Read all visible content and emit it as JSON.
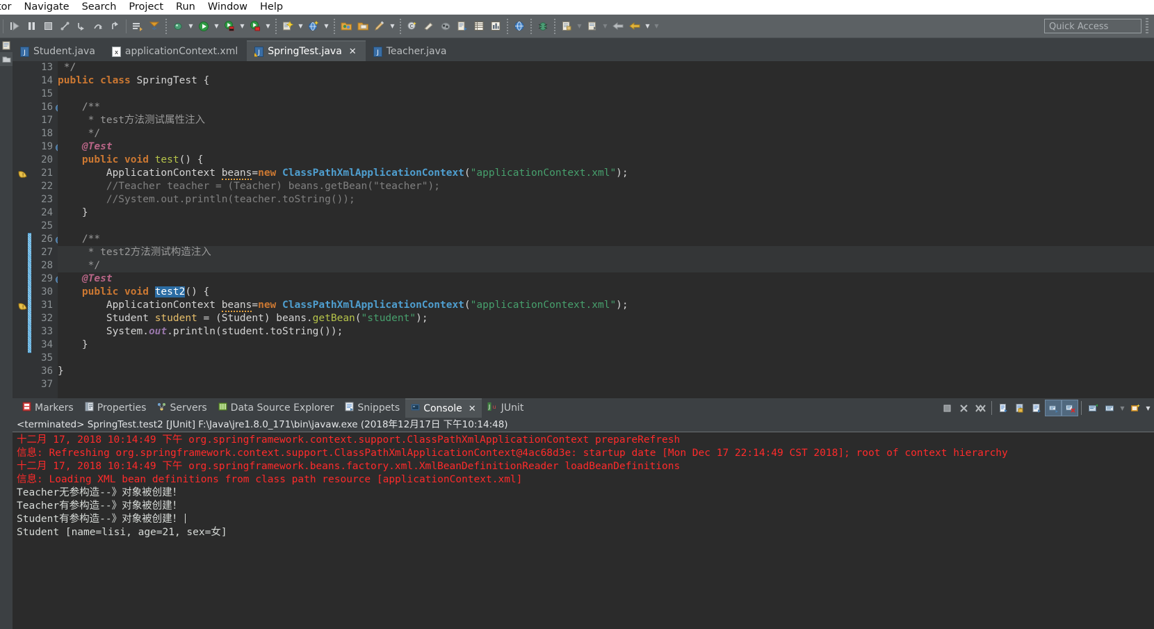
{
  "menubar": {
    "items": [
      {
        "label": "tor",
        "name": "menu-editor-clipped"
      },
      {
        "label": "Navigate",
        "name": "menu-navigate"
      },
      {
        "label": "Search",
        "name": "menu-search"
      },
      {
        "label": "Project",
        "name": "menu-project"
      },
      {
        "label": "Run",
        "name": "menu-run"
      },
      {
        "label": "Window",
        "name": "menu-window"
      },
      {
        "label": "Help",
        "name": "menu-help"
      }
    ]
  },
  "toolbar": {
    "quick_access_placeholder": "Quick Access",
    "buttons": [
      {
        "name": "skip-all-breakpoints-icon",
        "title": "Skip All Breakpoints"
      },
      {
        "name": "resume-icon",
        "title": "Resume"
      },
      {
        "name": "suspend-icon",
        "title": "Suspend"
      },
      {
        "name": "terminate-icon",
        "title": "Terminate"
      },
      {
        "name": "disconnect-icon",
        "title": "Disconnect"
      },
      {
        "name": "step-into-icon",
        "title": "Step Into"
      },
      {
        "name": "step-over-icon",
        "title": "Step Over"
      },
      {
        "name": "step-return-icon",
        "title": "Step Return"
      },
      {
        "name": "save-icon",
        "title": "Save"
      },
      {
        "name": "publish-icon",
        "title": "Publish"
      },
      {
        "name": "debug-icon",
        "title": "Debug"
      },
      {
        "name": "run-icon",
        "title": "Run"
      },
      {
        "name": "run-external-tools-icon",
        "title": "External Tools"
      },
      {
        "name": "coverage-icon",
        "title": "Coverage"
      },
      {
        "name": "new-wizard-icon",
        "title": "New"
      },
      {
        "name": "search-globe-icon",
        "title": "Open Type"
      },
      {
        "name": "open-folder-icon",
        "title": "Open Resource"
      },
      {
        "name": "open-package-icon",
        "title": "Open Package"
      },
      {
        "name": "quick-fix-icon",
        "title": "Quick Fix"
      },
      {
        "name": "new-class-icon",
        "title": "New Java Class"
      },
      {
        "name": "new-package-icon",
        "title": "New Package"
      },
      {
        "name": "java-perspective-icon",
        "title": "Java Perspective"
      },
      {
        "name": "new-report-icon",
        "title": "New Report"
      },
      {
        "name": "table-view-icon",
        "title": "Table View"
      },
      {
        "name": "chart-view-icon",
        "title": "Chart View"
      },
      {
        "name": "web-browser-icon",
        "title": "Web Browser"
      },
      {
        "name": "debug-ant-icon",
        "title": "Ant Build"
      },
      {
        "name": "annotation-icon",
        "title": "Annotation"
      },
      {
        "name": "previous-annotation-icon",
        "title": "Previous Annotation"
      },
      {
        "name": "back-icon",
        "title": "Back"
      },
      {
        "name": "forward-icon",
        "title": "Forward"
      }
    ]
  },
  "editor_tabs": [
    {
      "label": "Student.java",
      "icon": "java-file-icon",
      "active": false,
      "closable": false
    },
    {
      "label": "applicationContext.xml",
      "icon": "xml-file-icon",
      "active": false,
      "closable": false
    },
    {
      "label": "SpringTest.java",
      "icon": "java-file-warning-icon",
      "active": true,
      "closable": true,
      "close_label": "✕"
    },
    {
      "label": "Teacher.java",
      "icon": "java-file-icon",
      "active": false,
      "closable": false
    }
  ],
  "editor": {
    "lines": [
      {
        "num": "13",
        "fold": false,
        "marker": "",
        "changed": false,
        "tokens": [
          {
            "t": " */",
            "c": "jdoc"
          }
        ]
      },
      {
        "num": "14",
        "fold": false,
        "marker": "",
        "changed": false,
        "tokens": [
          {
            "t": "public class ",
            "c": "kw"
          },
          {
            "t": "SpringTest ",
            "c": "plain"
          },
          {
            "t": "{",
            "c": "plain"
          }
        ]
      },
      {
        "num": "15",
        "fold": false,
        "marker": "",
        "changed": false,
        "tokens": [
          {
            "t": "",
            "c": "plain"
          }
        ]
      },
      {
        "num": "16",
        "fold": true,
        "marker": "",
        "changed": false,
        "tokens": [
          {
            "t": "    /**",
            "c": "jdoc"
          }
        ]
      },
      {
        "num": "17",
        "fold": false,
        "marker": "",
        "changed": false,
        "tokens": [
          {
            "t": "     * test方法测试属性注入",
            "c": "jdoc"
          }
        ]
      },
      {
        "num": "18",
        "fold": false,
        "marker": "",
        "changed": false,
        "tokens": [
          {
            "t": "     */",
            "c": "jdoc"
          }
        ]
      },
      {
        "num": "19",
        "fold": true,
        "marker": "",
        "changed": false,
        "tokens": [
          {
            "t": "    @Test",
            "c": "ann"
          }
        ]
      },
      {
        "num": "20",
        "fold": false,
        "marker": "",
        "changed": false,
        "tokens": [
          {
            "t": "    ",
            "c": "plain"
          },
          {
            "t": "public void ",
            "c": "kw"
          },
          {
            "t": "test",
            "c": "mth"
          },
          {
            "t": "() {",
            "c": "plain"
          }
        ]
      },
      {
        "num": "21",
        "fold": false,
        "marker": "warning",
        "changed": false,
        "tokens": [
          {
            "t": "        ApplicationContext ",
            "c": "plain"
          },
          {
            "t": "beans",
            "c": "warnu"
          },
          {
            "t": "=",
            "c": "plain"
          },
          {
            "t": "new ",
            "c": "kw"
          },
          {
            "t": "ClassPathXmlApplicationContext",
            "c": "cls"
          },
          {
            "t": "(",
            "c": "plain"
          },
          {
            "t": "\"applicationContext.xml\"",
            "c": "str"
          },
          {
            "t": ");",
            "c": "plain"
          }
        ]
      },
      {
        "num": "22",
        "fold": false,
        "marker": "",
        "changed": false,
        "tokens": [
          {
            "t": "        //Teacher teacher = (Teacher) beans.getBean(\"teacher\");",
            "c": "cmt"
          }
        ]
      },
      {
        "num": "23",
        "fold": false,
        "marker": "",
        "changed": false,
        "tokens": [
          {
            "t": "        //System.out.println(teacher.toString());",
            "c": "cmt"
          }
        ]
      },
      {
        "num": "24",
        "fold": false,
        "marker": "",
        "changed": false,
        "tokens": [
          {
            "t": "    }",
            "c": "plain"
          }
        ]
      },
      {
        "num": "25",
        "fold": false,
        "marker": "",
        "changed": false,
        "tokens": [
          {
            "t": "",
            "c": "plain"
          }
        ]
      },
      {
        "num": "26",
        "fold": true,
        "marker": "",
        "changed": true,
        "tokens": [
          {
            "t": "    /**",
            "c": "jdoc"
          }
        ]
      },
      {
        "num": "27",
        "fold": false,
        "marker": "",
        "changed": true,
        "highlight": true,
        "tokens": [
          {
            "t": "     * test2方法测试构造注入",
            "c": "jdoc"
          }
        ]
      },
      {
        "num": "28",
        "fold": false,
        "marker": "",
        "changed": true,
        "highlight": true,
        "tokens": [
          {
            "t": "     */",
            "c": "jdoc"
          }
        ]
      },
      {
        "num": "29",
        "fold": true,
        "marker": "",
        "changed": true,
        "tokens": [
          {
            "t": "    @Test",
            "c": "ann"
          }
        ]
      },
      {
        "num": "30",
        "fold": false,
        "marker": "",
        "changed": true,
        "tokens": [
          {
            "t": "    ",
            "c": "plain"
          },
          {
            "t": "public void ",
            "c": "kw"
          },
          {
            "t": "test2",
            "c": "selbox"
          },
          {
            "t": "() {",
            "c": "plain"
          }
        ]
      },
      {
        "num": "31",
        "fold": false,
        "marker": "warning",
        "changed": true,
        "tokens": [
          {
            "t": "        ApplicationContext ",
            "c": "plain"
          },
          {
            "t": "beans",
            "c": "warnu"
          },
          {
            "t": "=",
            "c": "plain"
          },
          {
            "t": "new ",
            "c": "kw"
          },
          {
            "t": "ClassPathXmlApplicationContext",
            "c": "cls"
          },
          {
            "t": "(",
            "c": "plain"
          },
          {
            "t": "\"applicationContext.xml\"",
            "c": "str"
          },
          {
            "t": ");",
            "c": "plain"
          }
        ]
      },
      {
        "num": "32",
        "fold": false,
        "marker": "",
        "changed": true,
        "tokens": [
          {
            "t": "        Student ",
            "c": "plain"
          },
          {
            "t": "student",
            "c": "mthy"
          },
          {
            "t": " = (Student) beans.",
            "c": "plain"
          },
          {
            "t": "getBean",
            "c": "mth"
          },
          {
            "t": "(",
            "c": "plain"
          },
          {
            "t": "\"student\"",
            "c": "str"
          },
          {
            "t": ");",
            "c": "plain"
          }
        ]
      },
      {
        "num": "33",
        "fold": false,
        "marker": "",
        "changed": true,
        "tokens": [
          {
            "t": "        System.",
            "c": "plain"
          },
          {
            "t": "out",
            "c": "fld"
          },
          {
            "t": ".println(student.toString());",
            "c": "plain"
          }
        ]
      },
      {
        "num": "34",
        "fold": false,
        "marker": "",
        "changed": true,
        "tokens": [
          {
            "t": "    }",
            "c": "plain"
          }
        ]
      },
      {
        "num": "35",
        "fold": false,
        "marker": "",
        "changed": false,
        "tokens": [
          {
            "t": "",
            "c": "plain"
          }
        ]
      },
      {
        "num": "36",
        "fold": false,
        "marker": "",
        "changed": false,
        "tokens": [
          {
            "t": "}",
            "c": "plain"
          }
        ]
      },
      {
        "num": "37",
        "fold": false,
        "marker": "",
        "changed": false,
        "tokens": [
          {
            "t": "",
            "c": "plain"
          }
        ]
      }
    ]
  },
  "bottom_panel": {
    "tabs": [
      {
        "label": "Markers",
        "icon": "markers-icon",
        "active": false,
        "closable": false
      },
      {
        "label": "Properties",
        "icon": "properties-icon",
        "active": false,
        "closable": false
      },
      {
        "label": "Servers",
        "icon": "servers-icon",
        "active": false,
        "closable": false
      },
      {
        "label": "Data Source Explorer",
        "icon": "data-source-explorer-icon",
        "active": false,
        "closable": false
      },
      {
        "label": "Snippets",
        "icon": "snippets-icon",
        "active": false,
        "closable": false
      },
      {
        "label": "Console",
        "icon": "console-icon",
        "active": true,
        "closable": true,
        "close_label": "✕"
      },
      {
        "label": "JUnit",
        "icon": "junit-icon",
        "active": false,
        "closable": false
      }
    ],
    "tools": [
      {
        "name": "terminate-console-icon",
        "selected": false
      },
      {
        "name": "remove-launch-icon",
        "selected": false
      },
      {
        "name": "remove-all-terminated-icon",
        "selected": false
      },
      {
        "name": "clear-console-icon",
        "selected": false
      },
      {
        "name": "scroll-lock-icon",
        "selected": false
      },
      {
        "name": "pin-console-icon",
        "selected": false
      },
      {
        "name": "show-console-on-output-icon",
        "selected": true
      },
      {
        "name": "show-console-on-error-icon",
        "selected": true
      },
      {
        "name": "display-selected-console-icon",
        "selected": false
      },
      {
        "name": "open-console-icon",
        "selected": false
      },
      {
        "name": "open-console-dropdown-icon",
        "selected": false
      },
      {
        "name": "new-console-view-icon",
        "selected": false
      },
      {
        "name": "view-menu-icon",
        "selected": false
      }
    ],
    "console_header": "<terminated> SpringTest.test2 [JUnit] F:\\Java\\jre1.8.0_171\\bin\\javaw.exe (2018年12月17日 下午10:14:48)",
    "console_lines": [
      {
        "text": "十二月 17, 2018 10:14:49 下午 org.springframework.context.support.ClassPathXmlApplicationContext prepareRefresh",
        "kind": "err"
      },
      {
        "text": "信息: Refreshing org.springframework.context.support.ClassPathXmlApplicationContext@4ac68d3e: startup date [Mon Dec 17 22:14:49 CST 2018]; root of context hierarchy",
        "kind": "err"
      },
      {
        "text": "十二月 17, 2018 10:14:49 下午 org.springframework.beans.factory.xml.XmlBeanDefinitionReader loadBeanDefinitions",
        "kind": "err"
      },
      {
        "text": "信息: Loading XML bean definitions from class path resource [applicationContext.xml]",
        "kind": "err"
      },
      {
        "text": "Teacher无参构造--》对象被创建！",
        "kind": "out"
      },
      {
        "text": "Teacher有参构造--》对象被创建！",
        "kind": "out"
      },
      {
        "text": "Student有参构造--》对象被创建！",
        "kind": "out",
        "caret": true
      },
      {
        "text": "Student [name=lisi, age=21, sex=女]",
        "kind": "out"
      }
    ]
  },
  "colors": {
    "toolbar_bg": "#5c6164",
    "editor_bg": "#2b2b2b",
    "gutter_bg": "#313335",
    "tab_active_bg": "#4e5356",
    "console_error": "#ff2b2b",
    "console_output": "#d7dbd8",
    "keyword": "#cc7832",
    "string": "#47a06d",
    "class": "#4f9fd0",
    "comment": "#808080",
    "annotation": "#bb6688",
    "selection": "#2b6ca3"
  }
}
